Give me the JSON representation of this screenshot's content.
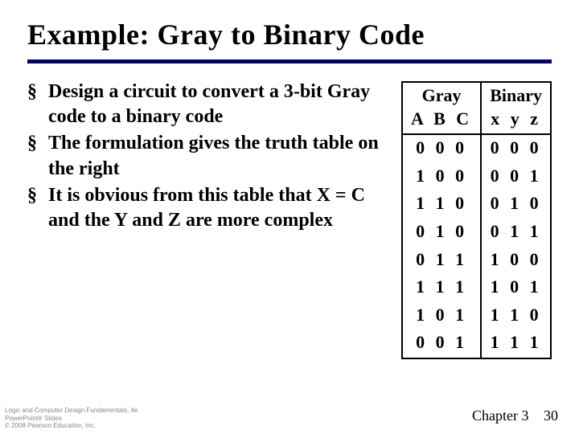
{
  "title": "Example:  Gray to Binary Code",
  "bullets": [
    "Design a circuit to convert a 3-bit Gray code to a binary code",
    "The formulation gives the truth table on the right",
    "It is obvious from this table that X = C and the Y and Z are more complex"
  ],
  "table": {
    "col1_header": "Gray",
    "col2_header": "Binary",
    "col1_sub": "A B C",
    "col2_sub": "x y z",
    "rows": [
      {
        "gray": "0 0 0",
        "bin": "0 0 0"
      },
      {
        "gray": "1 0 0",
        "bin": "0 0 1"
      },
      {
        "gray": "1 1 0",
        "bin": "0 1 0"
      },
      {
        "gray": "0 1 0",
        "bin": "0 1 1"
      },
      {
        "gray": "0 1 1",
        "bin": "1 0 0"
      },
      {
        "gray": "1 1 1",
        "bin": "1 0 1"
      },
      {
        "gray": "1 0 1",
        "bin": "1 1 0"
      },
      {
        "gray": "0 0 1",
        "bin": "1 1 1"
      }
    ]
  },
  "footer": {
    "book": "Logic and Computer Design Fundamentals, 4e",
    "subtitle": "PowerPoint® Slides",
    "copyright": "© 2008 Pearson Education, Inc.",
    "chapter": "Chapter 3",
    "page": "30"
  },
  "chart_data": {
    "type": "table",
    "title": "Gray to Binary truth table (3-bit)",
    "columns": [
      "Gray A",
      "Gray B",
      "Gray C",
      "Binary x",
      "Binary y",
      "Binary z"
    ],
    "rows": [
      [
        0,
        0,
        0,
        0,
        0,
        0
      ],
      [
        1,
        0,
        0,
        0,
        0,
        1
      ],
      [
        1,
        1,
        0,
        0,
        1,
        0
      ],
      [
        0,
        1,
        0,
        0,
        1,
        1
      ],
      [
        0,
        1,
        1,
        1,
        0,
        0
      ],
      [
        1,
        1,
        1,
        1,
        0,
        1
      ],
      [
        1,
        0,
        1,
        1,
        1,
        0
      ],
      [
        0,
        0,
        1,
        1,
        1,
        1
      ]
    ]
  }
}
